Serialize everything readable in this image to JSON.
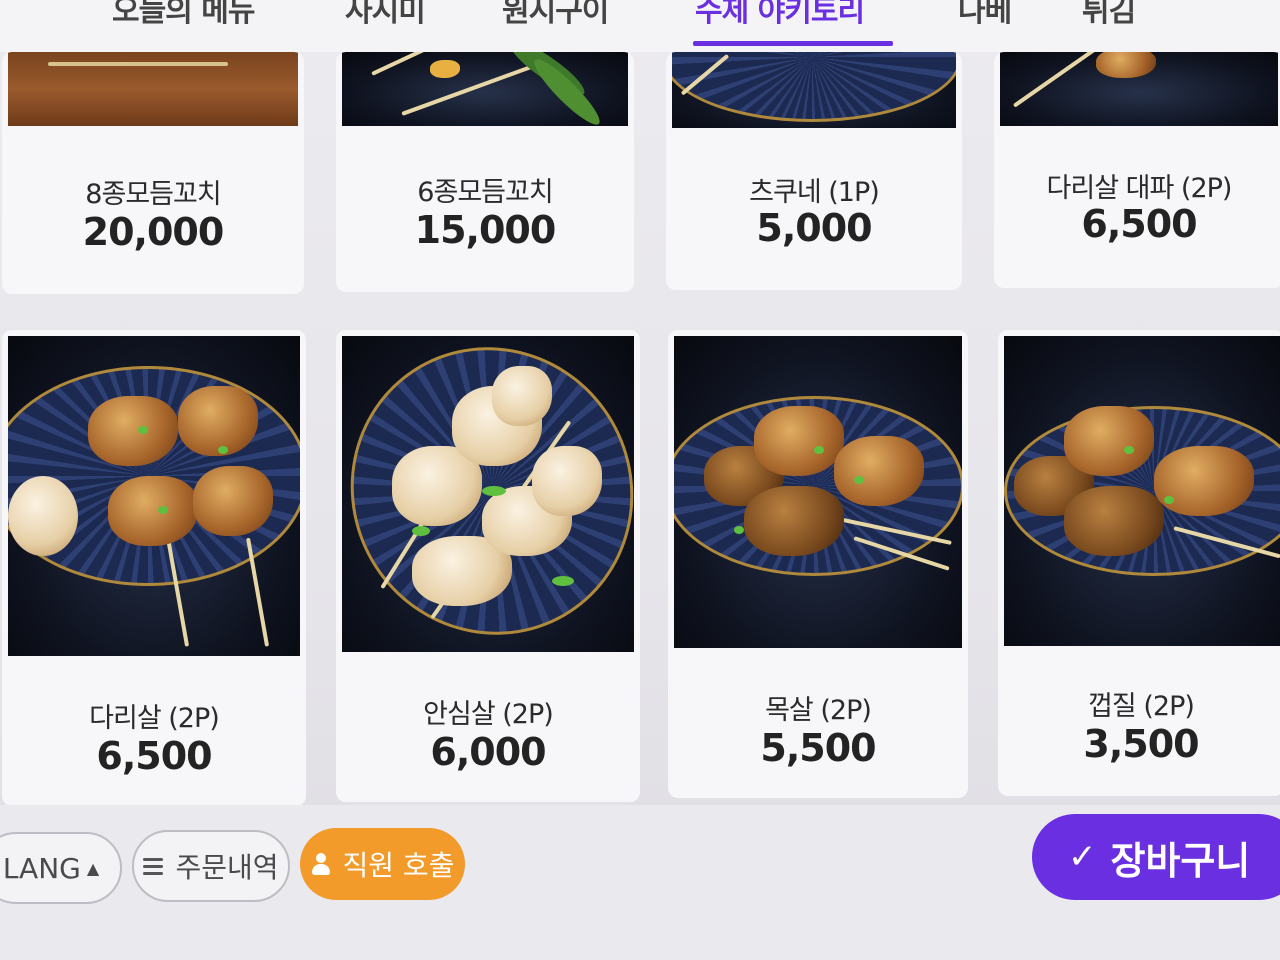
{
  "tabs": [
    {
      "label": "오늘의 메뉴"
    },
    {
      "label": "사시미"
    },
    {
      "label": "원시구이"
    },
    {
      "label": "수제 야키토리"
    },
    {
      "label": "나베"
    },
    {
      "label": "튀김"
    }
  ],
  "active_tab": "수제 야키토리",
  "menu": [
    {
      "name": "8종모듬꼬치",
      "price": "20,000"
    },
    {
      "name": "6종모듬꼬치",
      "price": "15,000"
    },
    {
      "name": "츠쿠네 (1P)",
      "price": "5,000"
    },
    {
      "name": "다리살 대파 (2P)",
      "price": "6,500"
    },
    {
      "name": "다리살 (2P)",
      "price": "6,500"
    },
    {
      "name": "안심살 (2P)",
      "price": "6,000"
    },
    {
      "name": "목살 (2P)",
      "price": "5,500"
    },
    {
      "name": "껍질 (2P)",
      "price": "3,500"
    }
  ],
  "bottom": {
    "lang_label": "LANG",
    "lang_arrow": "▲",
    "orders_label": "주문내역",
    "call_label": "직원 호출",
    "cart_check": "✓",
    "cart_label": "장바구니"
  },
  "colors": {
    "accent": "#6a2fe0",
    "call_button": "#f29a2a"
  }
}
